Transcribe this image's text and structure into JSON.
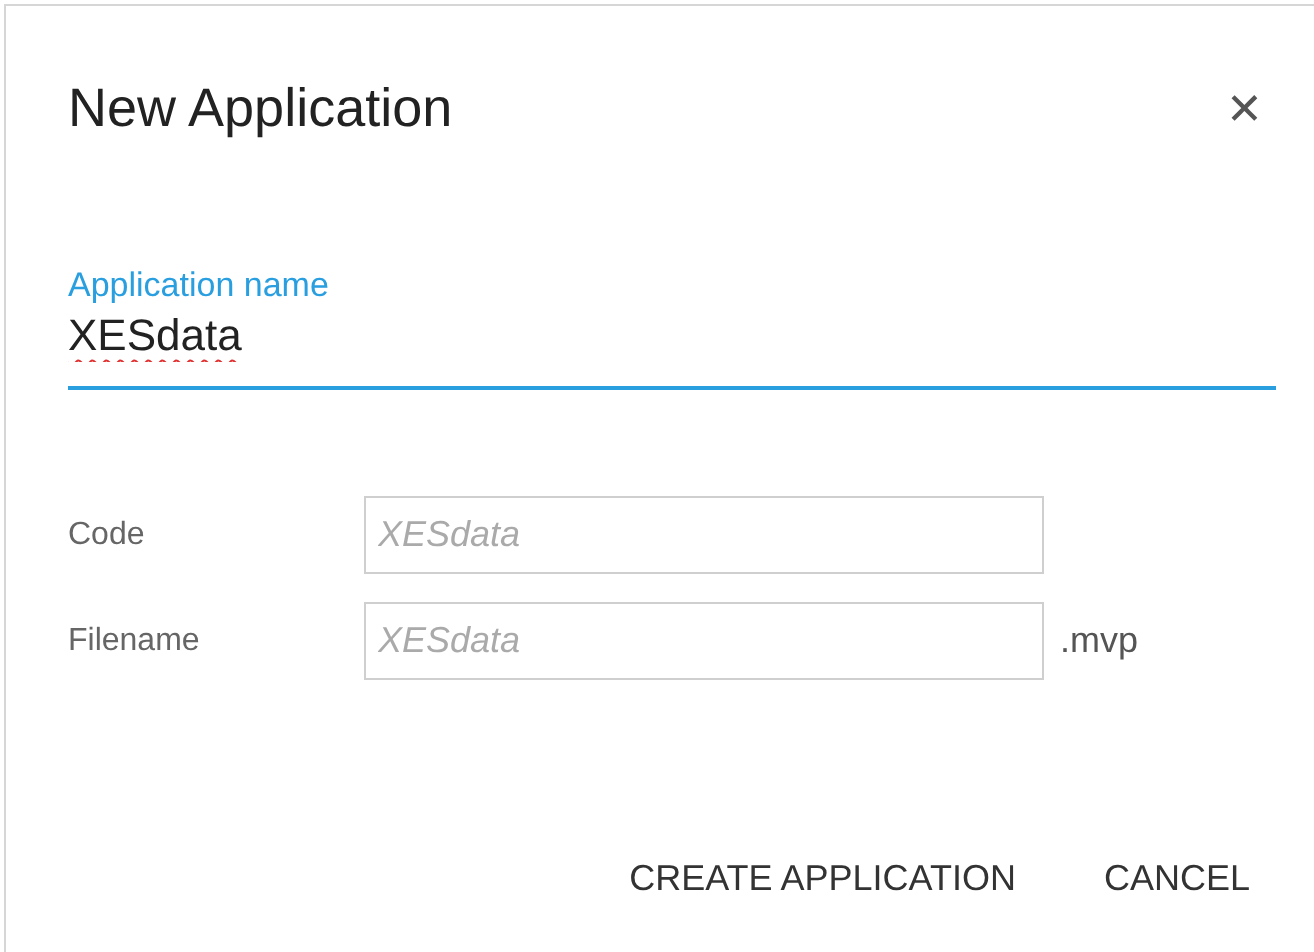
{
  "dialog": {
    "title": "New Application",
    "close": "✕"
  },
  "name_field": {
    "label": "Application name",
    "value": "XESdata",
    "misspelled": true
  },
  "fields": [
    {
      "label": "Code",
      "placeholder": "XESdata"
    },
    {
      "label": "Filename",
      "placeholder": "XESdata",
      "suffix": ".mvp"
    }
  ],
  "buttons": [
    "CREATE APPLICATION",
    "CANCEL"
  ]
}
